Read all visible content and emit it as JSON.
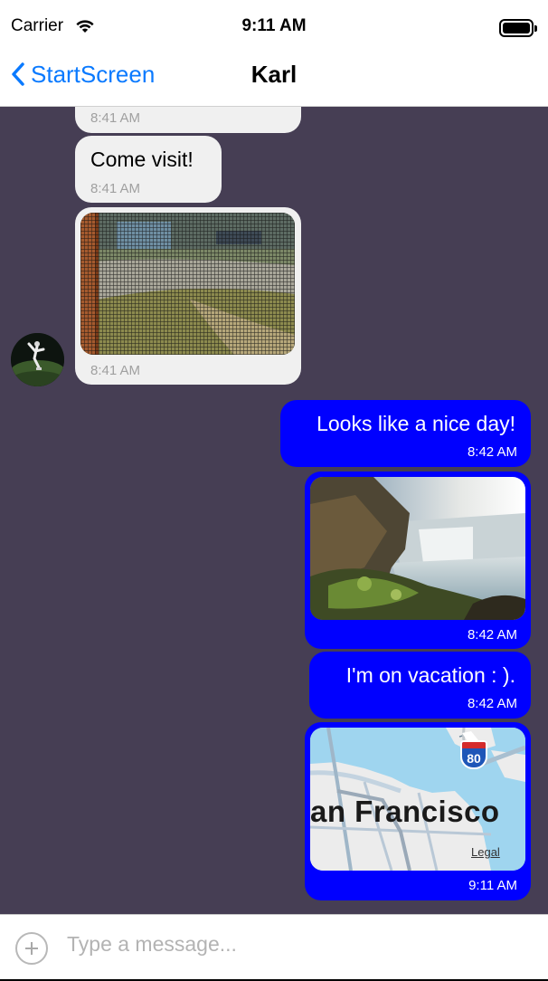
{
  "status_bar": {
    "carrier": "Carrier",
    "time": "9:11 AM"
  },
  "nav": {
    "back_label": "StartScreen",
    "title": "Karl"
  },
  "messages": [
    {
      "direction": "incoming",
      "type": "text",
      "text": "",
      "time": "8:41 AM"
    },
    {
      "direction": "incoming",
      "type": "text",
      "text": "Come visit!",
      "time": "8:41 AM"
    },
    {
      "direction": "incoming",
      "type": "image",
      "image": "street-through-window-screen-photo",
      "time": "8:41 AM"
    },
    {
      "direction": "outgoing",
      "type": "text",
      "text": "Looks like a nice day!",
      "time": "8:42 AM"
    },
    {
      "direction": "outgoing",
      "type": "image",
      "image": "waterfall-landscape-photo",
      "time": "8:42 AM"
    },
    {
      "direction": "outgoing",
      "type": "text",
      "text": "I'm on vacation : ).",
      "time": "8:42 AM"
    },
    {
      "direction": "outgoing",
      "type": "location",
      "map_label": "an Francisco",
      "highway_shield": "80",
      "legal_link": "Legal",
      "time": "9:11 AM"
    }
  ],
  "composer": {
    "placeholder": "Type a message..."
  },
  "colors": {
    "chat_background": "#463e54",
    "outgoing_bubble": "#0000ff",
    "incoming_bubble": "#f0f0f0",
    "link_blue": "#0a7aff"
  }
}
